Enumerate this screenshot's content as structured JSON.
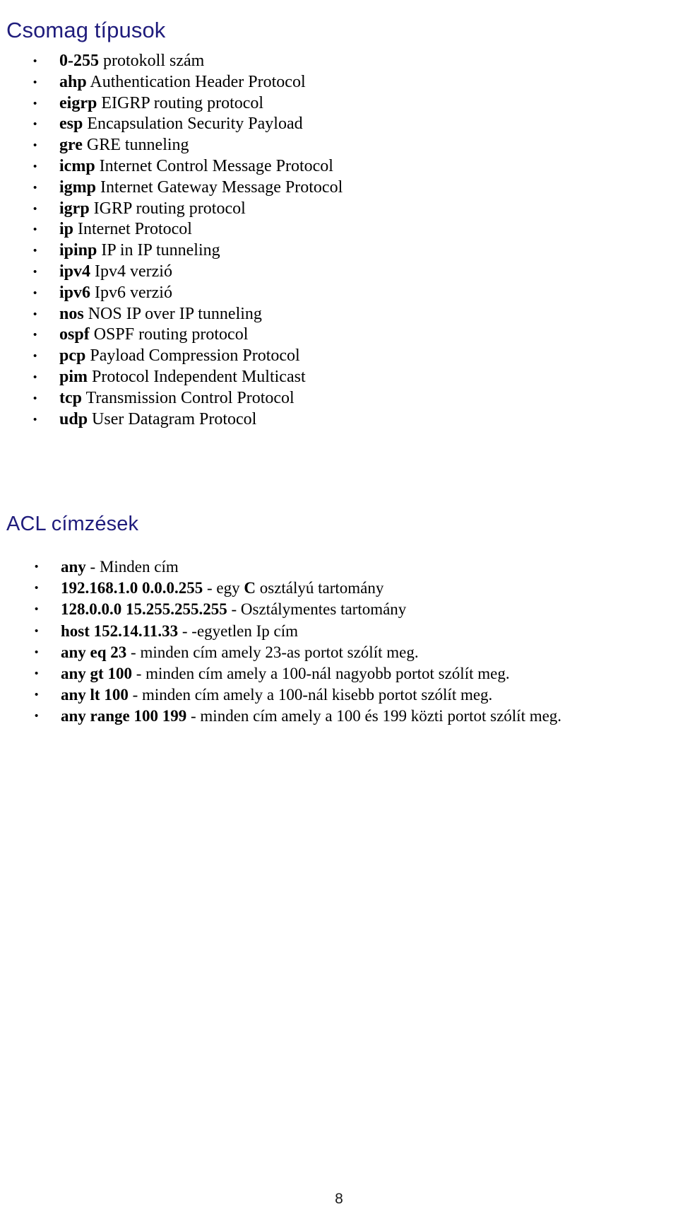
{
  "page": {
    "number": "8",
    "language": "hu"
  },
  "sections": [
    {
      "heading": "Csomag típusok",
      "heading_color": "#1F1C7C",
      "items": [
        {
          "keyword": "0-255",
          "description": " protokoll szám"
        },
        {
          "keyword": "ahp",
          "description": " Authentication Header Protocol"
        },
        {
          "keyword": "eigrp",
          "description": " EIGRP routing protocol"
        },
        {
          "keyword": "esp",
          "description": " Encapsulation Security Payload"
        },
        {
          "keyword": "gre",
          "description": " GRE tunneling"
        },
        {
          "keyword": "icmp",
          "description": " Internet Control Message Protocol"
        },
        {
          "keyword": "igmp",
          "description": " Internet Gateway Message Protocol"
        },
        {
          "keyword": "igrp",
          "description": " IGRP routing protocol"
        },
        {
          "keyword": "ip",
          "description": " Internet Protocol"
        },
        {
          "keyword": "ipinp",
          "description": " IP in IP tunneling"
        },
        {
          "keyword": "ipv4",
          "description": " Ipv4 verzió"
        },
        {
          "keyword": "ipv6",
          "description": " Ipv6 verzió"
        },
        {
          "keyword": "nos",
          "description": " NOS IP over IP tunneling"
        },
        {
          "keyword": "ospf",
          "description": " OSPF routing protocol"
        },
        {
          "keyword": "pcp",
          "description": " Payload Compression Protocol"
        },
        {
          "keyword": "pim",
          "description": " Protocol Independent Multicast"
        },
        {
          "keyword": "tcp",
          "description": " Transmission Control Protocol"
        },
        {
          "keyword": "udp",
          "description": " User Datagram Protocol"
        }
      ]
    },
    {
      "heading": "ACL címzések",
      "heading_color": "#1F1C7C",
      "items": [
        {
          "keyword": "any",
          "description": " - Minden cím"
        },
        {
          "keyword": "192.168.1.0 0.0.0.255",
          "description": " - egy ",
          "emphasis": "C",
          "description_tail": " osztályú tartomány"
        },
        {
          "keyword": "128.0.0.0 15.255.255.255",
          "description": " - Osztálymentes tartomány"
        },
        {
          "keyword": "host 152.14.11.33",
          "description": " - -egyetlen Ip cím"
        },
        {
          "keyword": "any eq 23",
          "description": " - minden cím amely 23-as portot szólít meg."
        },
        {
          "keyword": "any gt 100",
          "description": " - minden cím amely a 100-nál nagyobb portot szólít meg."
        },
        {
          "keyword": "any lt 100",
          "description": " - minden cím amely a 100-nál kisebb portot szólít meg."
        },
        {
          "keyword": "any range 100 199",
          "description": " - minden cím amely a 100 és 199 közti portot szólít meg."
        }
      ]
    }
  ]
}
